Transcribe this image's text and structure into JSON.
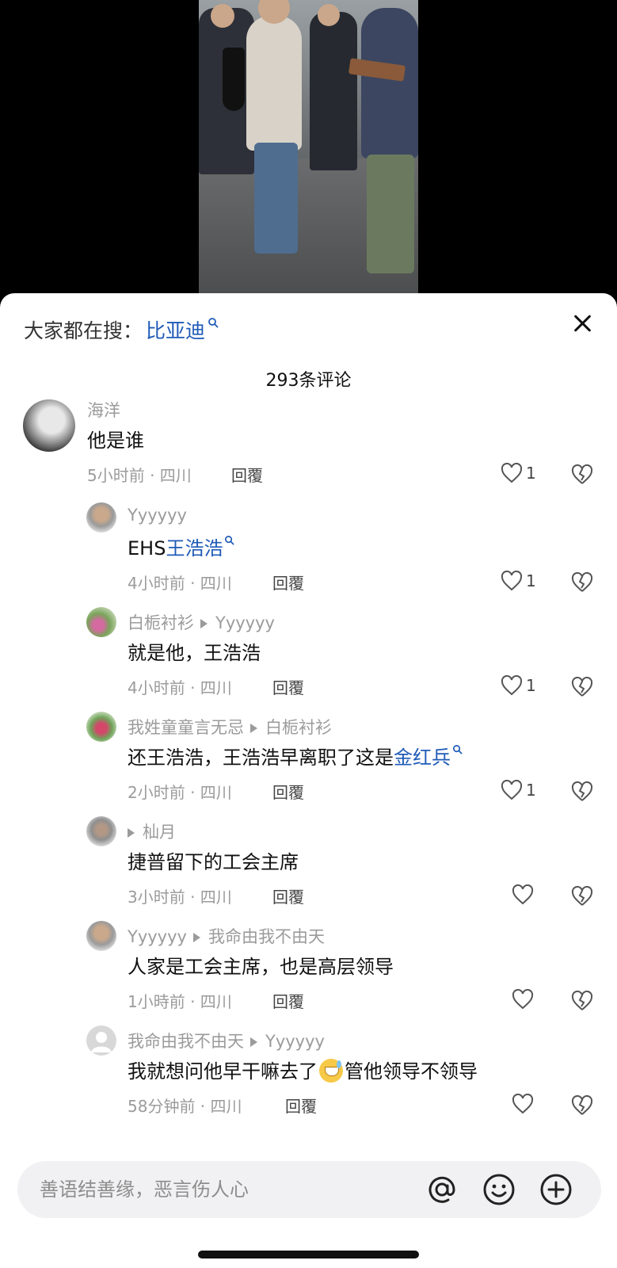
{
  "search": {
    "prefix": "大家都在搜：",
    "term": "比亚迪"
  },
  "header": {
    "count_title": "293条评论"
  },
  "comments": [
    {
      "user": "海洋",
      "text": "他是谁",
      "meta": "5小时前 · 四川",
      "reply": "回覆",
      "likes": "1"
    },
    {
      "user": "Yyyyyy",
      "text_prefix": "EHS",
      "text_link": "王浩浩",
      "meta": "4小时前 · 四川",
      "reply": "回覆",
      "likes": "1"
    },
    {
      "user": "白栀衬衫",
      "reply_to": "Yyyyyy",
      "text": "就是他，王浩浩",
      "meta": "4小时前 · 四川",
      "reply": "回覆",
      "likes": "1"
    },
    {
      "user": "我姓童童言无忌",
      "reply_to": "白栀衬衫",
      "text_prefix": "还王浩浩，王浩浩早离职了这是",
      "text_link": "金红兵",
      "meta": "2小时前 · 四川",
      "reply": "回覆",
      "likes": "1"
    },
    {
      "user": "杣月",
      "text": "捷普留下的工会主席",
      "meta": "3小时前 · 四川",
      "reply": "回覆",
      "likes": ""
    },
    {
      "user": "Yyyyyy",
      "reply_to": "我命由我不由天",
      "text": "人家是工会主席，也是高层领导",
      "meta": "1小時前 · 四川",
      "reply": "回覆",
      "likes": ""
    },
    {
      "user": "我命由我不由天",
      "reply_to": "Yyyyyy",
      "text_prefix": "我就想问他早干嘛去了",
      "text_suffix": "管他领导不领导",
      "meta": "58分钟前 · 四川",
      "reply": "回覆",
      "likes": ""
    }
  ],
  "input": {
    "placeholder": "善语结善缘，恶言伤人心"
  },
  "icons": {
    "search_mag": "search-icon",
    "close": "close-icon",
    "like": "heart-icon",
    "dislike": "broken-heart-icon",
    "mention": "at-icon",
    "emoji": "smiley-icon",
    "add": "plus-circle-icon"
  },
  "colors": {
    "link": "#1f5bb7",
    "muted": "#9b9b9b",
    "sheet_bg": "#ffffff",
    "input_bg": "#f1f1f3"
  }
}
